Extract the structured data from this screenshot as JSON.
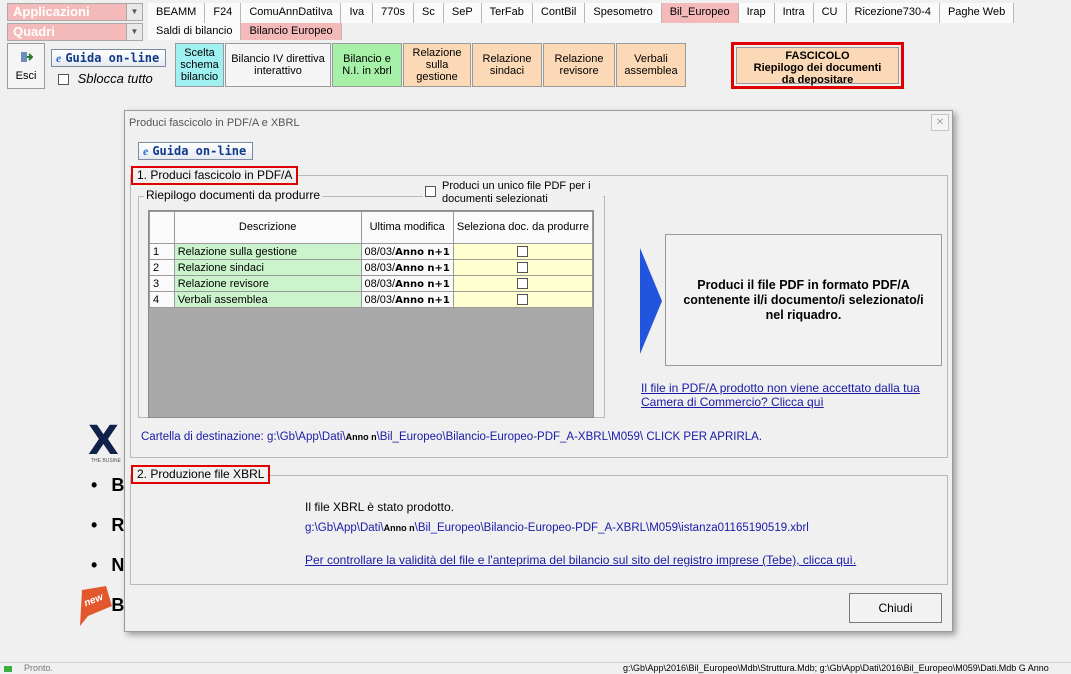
{
  "selectors": {
    "applicazioni": "Applicazioni",
    "quadri": "Quadri"
  },
  "tabs_top": [
    {
      "label": "BEAMM",
      "active": false
    },
    {
      "label": "F24",
      "active": false
    },
    {
      "label": "ComuAnnDatiIva",
      "active": false
    },
    {
      "label": "Iva",
      "active": false
    },
    {
      "label": "770s",
      "active": false
    },
    {
      "label": "Sc",
      "active": false
    },
    {
      "label": "SeP",
      "active": false
    },
    {
      "label": "TerFab",
      "active": false
    },
    {
      "label": "ContBil",
      "active": false
    },
    {
      "label": "Spesometro",
      "active": false
    },
    {
      "label": "Bil_Europeo",
      "active": true
    },
    {
      "label": "Irap",
      "active": false
    },
    {
      "label": "Intra",
      "active": false
    },
    {
      "label": "CU",
      "active": false
    },
    {
      "label": "Ricezione730-4",
      "active": false
    },
    {
      "label": "Paghe Web",
      "active": false
    }
  ],
  "tabs_sub": [
    {
      "label": "Saldi di bilancio",
      "active": false
    },
    {
      "label": "Bilancio Europeo",
      "active": true
    }
  ],
  "toolbar": {
    "esci": "Esci",
    "guida": "Guida on-line",
    "sblocca": "Sblocca tutto",
    "scelta_schema": "Scelta schema bilancio",
    "bilancio_iv": "Bilancio IV direttiva interattivo",
    "bilancio_ni": "Bilancio e N.I. in xbrl",
    "relazione_gestione": "Relazione sulla gestione",
    "relazione_sindaci": "Relazione sindaci",
    "relazione_revisore": "Relazione revisore",
    "verbali_assemblea": "Verbali assemblea",
    "fascicolo_title": "FASCICOLO",
    "fascicolo_sub": "Riepilogo dei documenti da depositare"
  },
  "background_page": {
    "logo_fragment": "X",
    "logo_tagline": "THE BUSINE",
    "bullets": [
      "B",
      "R",
      "N",
      "B"
    ],
    "new_badge": "new"
  },
  "dialog": {
    "title": "Produci fascicolo in PDF/A e XBRL",
    "close_icon": "close-icon",
    "guida": "Guida on-line",
    "section1_label": "1. Produci fascicolo in PDF/A",
    "riepilogo_label": "Riepilogo documenti da produrre",
    "unico_pdf_label": "Produci un unico file PDF per i documenti selezionati",
    "grid": {
      "headers": [
        "Descrizione",
        "Ultima modifica",
        "Seleziona doc. da produrre"
      ],
      "rows": [
        {
          "n": "1",
          "descrizione": "Relazione sulla gestione",
          "data": "08/03/",
          "anno": "Anno n+1",
          "selected": false
        },
        {
          "n": "2",
          "descrizione": "Relazione sindaci",
          "data": "08/03/",
          "anno": "Anno n+1",
          "selected": false
        },
        {
          "n": "3",
          "descrizione": "Relazione revisore",
          "data": "08/03/",
          "anno": "Anno n+1",
          "selected": false
        },
        {
          "n": "4",
          "descrizione": "Verbali assemblea",
          "data": "08/03/",
          "anno": "Anno n+1",
          "selected": false
        }
      ]
    },
    "produci_pdf_button": "Produci il file PDF in formato PDF/A contenente il/i documento/i selezionato/i nel riquadro.",
    "link_camera": "Il file in PDF/A prodotto non viene accettato dalla tua Camera di Commercio? Clicca quì",
    "cartella_label": "Cartella di destinazione:",
    "cartella_path_a": "g:\\Gb\\App\\Dati\\",
    "cartella_anno": "Anno n",
    "cartella_path_b": "\\Bil_Europeo\\Bilancio-Europeo-PDF_A-XBRL\\M059\\",
    "cartella_click": "CLICK PER APRIRLA.",
    "section2_label": "2. Produzione file XBRL",
    "xbrl_status": "Il file XBRL è stato prodotto.",
    "xbrl_path_a": "g:\\Gb\\App\\Dati\\",
    "xbrl_anno": "Anno n",
    "xbrl_path_b": "\\Bil_Europeo\\Bilancio-Europeo-PDF_A-XBRL\\M059\\istanza01165190519.xbrl",
    "xbrl_link": "Per controllare la validità del file e l'anteprima del bilancio sul sito del registro imprese (Tebe), clicca quì.",
    "chiudi": "Chiudi"
  },
  "statusbar": {
    "left": "Pronto.",
    "right": "g:\\Gb\\App\\2016\\Bil_Europeo\\Mdb\\Struttura.Mdb; g:\\Gb\\App\\Dati\\2016\\Bil_Europeo\\M059\\Dati.Mdb G  Anno"
  },
  "colors": {
    "active_tab": "#f4b9b9",
    "grid_desc": "#ccf4cc",
    "grid_select": "#ffffd0",
    "highlight_red": "#e00000",
    "link_blue": "#1a1aa6",
    "arrow_blue": "#2255dd"
  }
}
